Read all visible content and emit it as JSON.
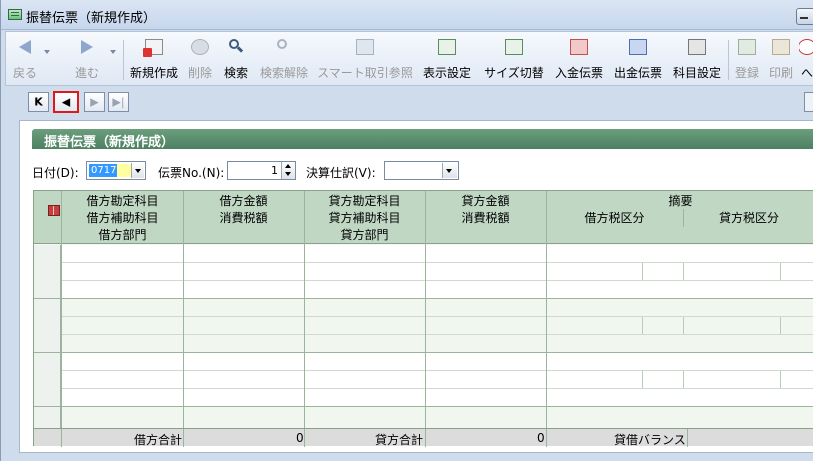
{
  "window": {
    "title": "振替伝票（新規作成）"
  },
  "toolbar": {
    "items": [
      {
        "label": "戻る",
        "icon": "back-arrow-icon"
      },
      {
        "label": "進む",
        "icon": "forward-arrow-icon"
      },
      {
        "label": "新規作成",
        "icon": "new-document-icon"
      },
      {
        "label": "削除",
        "icon": "delete-icon"
      },
      {
        "label": "検索",
        "icon": "search-icon"
      },
      {
        "label": "検索解除",
        "icon": "clear-search-icon"
      },
      {
        "label": "スマート取引参照",
        "icon": "smart-reference-icon"
      },
      {
        "label": "表示設定",
        "icon": "display-settings-icon"
      },
      {
        "label": "サイズ切替",
        "icon": "size-toggle-icon"
      },
      {
        "label": "入金伝票",
        "icon": "receipt-slip-icon"
      },
      {
        "label": "出金伝票",
        "icon": "payment-slip-icon"
      },
      {
        "label": "科目設定",
        "icon": "account-settings-icon"
      },
      {
        "label": "登録",
        "icon": "register-icon"
      },
      {
        "label": "印刷",
        "icon": "print-icon"
      },
      {
        "label": "へ",
        "icon": "more-icon"
      }
    ]
  },
  "navigation": {
    "first": "K",
    "prev": "◀",
    "next": "▶",
    "last": "▶|"
  },
  "form": {
    "section_title": "振替伝票（新規作成）",
    "date_label": "日付(D):",
    "date_value": "0717",
    "slip_no_label": "伝票No.(N):",
    "slip_no_value": "1",
    "kessan_label": "決算仕訳(V):",
    "kessan_value": ""
  },
  "grid": {
    "headers_row1": [
      "借方勘定科目",
      "借方金額",
      "貸方勘定科目",
      "貸方金額",
      "摘要"
    ],
    "headers_row2": [
      "借方補助科目",
      "消費税額",
      "貸方補助科目",
      "消費税額",
      "借方税区分",
      "貸方税区分"
    ],
    "headers_row3": [
      "借方部門",
      "貸方部門"
    ],
    "footer": {
      "debit_total_label": "借方合計",
      "debit_total_value": "0",
      "credit_total_label": "貸方合計",
      "credit_total_value": "0",
      "balance_label": "貸借バランス"
    }
  },
  "colors": {
    "section_header": "#5a8f6e",
    "grid_header": "#bfd7c3",
    "active_nav_border": "#e01818",
    "selection": "#3399ff"
  }
}
